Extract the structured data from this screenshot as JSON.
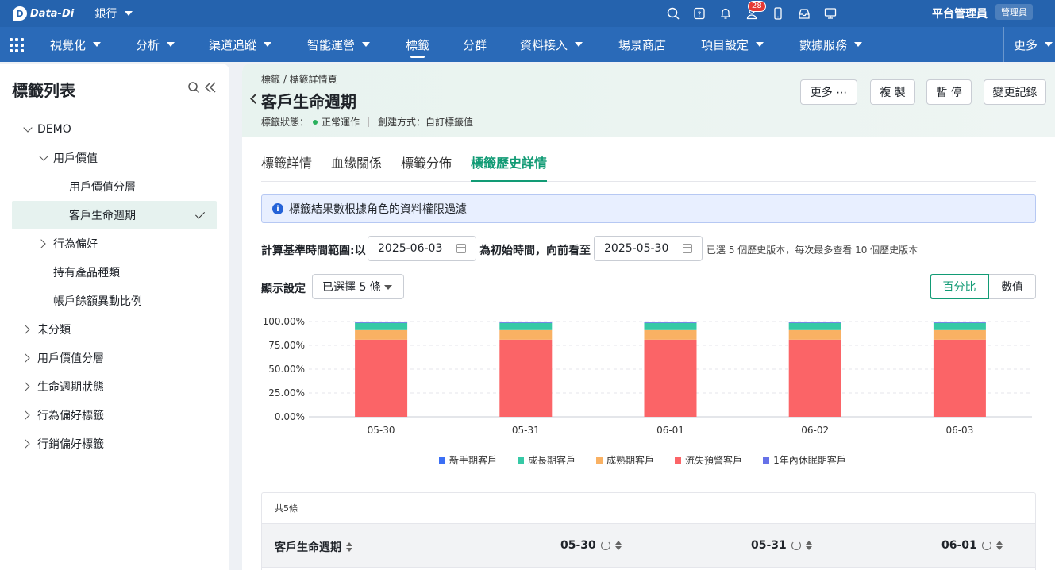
{
  "topbar": {
    "logo_text": "Data-Di",
    "logo_mark": "D",
    "org": "銀行",
    "icons": [
      "search-icon",
      "help-icon",
      "bell-icon",
      "user-icon",
      "mobile-icon",
      "inbox-icon",
      "monitor-icon"
    ],
    "notification_count": "28",
    "user_name": "平台管理員",
    "user_role": "管理員"
  },
  "nav": {
    "items": [
      {
        "label": "視覺化",
        "dropdown": true
      },
      {
        "label": "分析",
        "dropdown": true
      },
      {
        "label": "渠道追蹤",
        "dropdown": true
      },
      {
        "label": "智能運營",
        "dropdown": true
      },
      {
        "label": "標籤",
        "dropdown": false,
        "active": true
      },
      {
        "label": "分群",
        "dropdown": false
      },
      {
        "label": "資料接入",
        "dropdown": true
      },
      {
        "label": "場景商店",
        "dropdown": false
      },
      {
        "label": "項目設定",
        "dropdown": true
      },
      {
        "label": "數據服務",
        "dropdown": true
      }
    ],
    "more": "更多"
  },
  "sidebar": {
    "title": "標籤列表",
    "tree": [
      {
        "label": "DEMO",
        "expand": "down"
      },
      {
        "label": "用戶價值",
        "expand": "down"
      },
      {
        "label": "用戶價值分層",
        "expand": "none"
      },
      {
        "label": "客戶生命週期",
        "expand": "none",
        "selected": true
      },
      {
        "label": "行為偏好",
        "expand": "right"
      },
      {
        "label": "持有產品種類",
        "expand": "none"
      },
      {
        "label": "帳戶餘額異動比例",
        "expand": "none"
      },
      {
        "label": "未分類",
        "expand": "right"
      },
      {
        "label": "用戶價值分層",
        "expand": "right"
      },
      {
        "label": "生命週期狀態",
        "expand": "right"
      },
      {
        "label": "行為偏好標籤",
        "expand": "right"
      },
      {
        "label": "行銷偏好標籤",
        "expand": "right"
      }
    ]
  },
  "header": {
    "breadcrumb": "標籤 / 標籤詳情頁",
    "title": "客戶生命週期",
    "status_label": "標籤狀態：",
    "status_value": "正常運作",
    "create_label": "創建方式：自訂標籤值",
    "buttons": {
      "more": "更多 ⋯",
      "copy": "複 製",
      "pause": "暫 停",
      "changelog": "變更記錄"
    }
  },
  "tabs": [
    "標籤詳情",
    "血緣關係",
    "標籤分佈",
    "標籤歷史詳情"
  ],
  "info": {
    "icon": "i",
    "text": "標籤結果數根據角色的資料權限過濾"
  },
  "range": {
    "label_prefix": "計算基準時間範圍:以",
    "start_date": "2025-06-03",
    "label_mid": "為初始時間，向前看至",
    "end_date": "2025-05-30",
    "hint": "已選 5 個歷史版本，每次最多查看 10 個歷史版本"
  },
  "display": {
    "label": "顯示設定",
    "selected": "已選擇 5 條",
    "mode_percent": "百分比",
    "mode_value": "數值",
    "active_mode": "percent"
  },
  "chart_data": {
    "type": "bar",
    "stacked": true,
    "categories": [
      "05-30",
      "05-31",
      "06-01",
      "06-02",
      "06-03"
    ],
    "y_ticks": [
      "0.00%",
      "25.00%",
      "50.00%",
      "75.00%",
      "100.00%"
    ],
    "ylim": [
      0,
      100
    ],
    "grid": true,
    "legend_position": "bottom",
    "series": [
      {
        "name": "新手期客戶",
        "color": "#3b6ff5",
        "values": [
          0.5,
          0.5,
          0.5,
          0.5,
          0.5
        ]
      },
      {
        "name": "成長期客戶",
        "color": "#36c9a6",
        "values": [
          7.5,
          7.5,
          7.5,
          7.5,
          7.5
        ]
      },
      {
        "name": "成熟期客戶",
        "color": "#f9b163",
        "values": [
          10,
          10,
          10,
          10,
          10
        ]
      },
      {
        "name": "流失預警客戶",
        "color": "#fb6467",
        "values": [
          81,
          81,
          81,
          81,
          81
        ]
      },
      {
        "name": "1年內休眠期客戶",
        "color": "#6671e8",
        "values": [
          1,
          1,
          1,
          1,
          1
        ]
      }
    ]
  },
  "table": {
    "count": "共5條",
    "headers": [
      "客戶生命週期",
      "05-30",
      "05-31",
      "06-01"
    ]
  }
}
